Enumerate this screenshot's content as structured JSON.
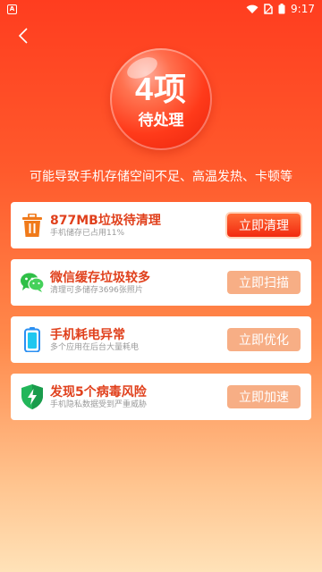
{
  "status_bar": {
    "app_icon_letter": "A",
    "time": "9:17"
  },
  "hero": {
    "count": "4项",
    "subtitle": "待处理",
    "tagline": "可能导致手机存储空间不足、高温发热、卡顿等"
  },
  "items": [
    {
      "title": "877MB垃圾待清理",
      "subtitle": "手机储存已占用11%",
      "button": "立即清理",
      "icon": "trash-icon"
    },
    {
      "title": "微信缓存垃圾较多",
      "subtitle": "清理可多储存3696张照片",
      "button": "立即扫描",
      "icon": "wechat-icon"
    },
    {
      "title": "手机耗电异常",
      "subtitle": "多个应用在后台大量耗电",
      "button": "立即优化",
      "icon": "battery-icon"
    },
    {
      "title": "发现5个病毒风险",
      "subtitle": "手机隐私数据受到严重威胁",
      "button": "立即加速",
      "icon": "shield-icon"
    }
  ],
  "colors": {
    "accent": "#e0401c",
    "button_primary": "#f22a10",
    "button_secondary": "#f7ae85"
  }
}
